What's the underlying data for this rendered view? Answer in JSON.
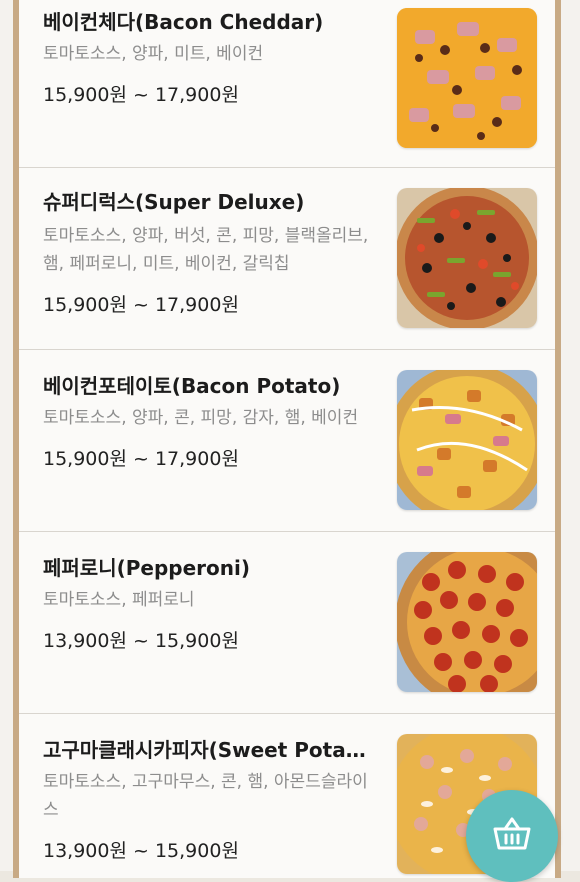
{
  "menu": {
    "items": [
      {
        "name": "베이컨체다(Bacon Cheddar)",
        "toppings": "토마토소스, 양파, 미트, 베이컨",
        "price": "15,900원 ~ 17,900원",
        "image": "bacon-cheddar-pizza-photo"
      },
      {
        "name": "슈퍼디럭스(Super Deluxe)",
        "toppings": "토마토소스, 양파, 버섯, 콘, 피망, 블랙올리브, 햄, 페퍼로니, 미트, 베이컨, 갈릭칩",
        "price": "15,900원 ~ 17,900원",
        "image": "super-deluxe-pizza-photo"
      },
      {
        "name": "베이컨포테이토(Bacon Potato)",
        "toppings": "토마토소스, 양파, 콘, 피망, 감자, 햄, 베이컨",
        "price": "15,900원 ~ 17,900원",
        "image": "bacon-potato-pizza-photo"
      },
      {
        "name": "페퍼로니(Pepperoni)",
        "toppings": "토마토소스, 페퍼로니",
        "price": "13,900원 ~ 15,900원",
        "image": "pepperoni-pizza-photo"
      },
      {
        "name": "고구마클래시카피자(Sweet Potato Classica)",
        "toppings": "토마토소스, 고구마무스, 콘, 햄, 아몬드슬라이스",
        "price": "13,900원 ~ 15,900원",
        "image": "sweet-potato-pizza-photo"
      }
    ]
  },
  "cart_button": {
    "icon": "basket-icon"
  },
  "colors": {
    "accent": "#5fbfbe",
    "frame": "#c8aa85",
    "topping_text": "#8d8d8d"
  }
}
